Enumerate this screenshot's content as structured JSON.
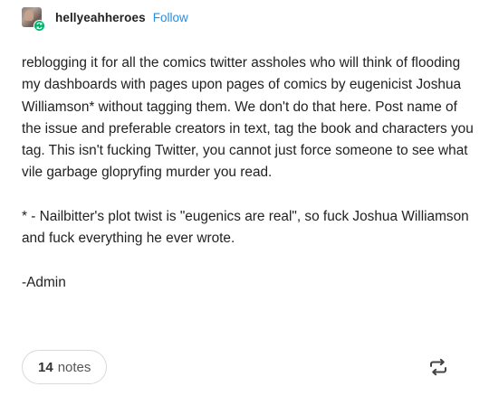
{
  "header": {
    "username": "hellyeahheroes",
    "follow_label": "Follow"
  },
  "post": {
    "paragraphs": [
      "reblogging it for all the comics twitter assholes who will think of flooding my dashboards with pages upon pages of comics by eugenicist Joshua Williamson* without tagging them. We don't do that here. Post name of the issue and  preferable creators in text, tag the book and characters you tag. This isn't fucking Twitter, you cannot just force someone to see what vile garbage glopryfing murder you read.",
      "* - Nailbitter's plot twist is \"eugenics are real\", so fuck Joshua Williamson and fuck everything he ever wrote.",
      "-Admin"
    ]
  },
  "footer": {
    "notes_count": "14",
    "notes_label": "notes",
    "reblog_icon": "reblog-icon"
  },
  "colors": {
    "accent": "#1f8fe8",
    "badge": "#00b36b",
    "text": "#222222",
    "border": "#d9d9d9"
  }
}
